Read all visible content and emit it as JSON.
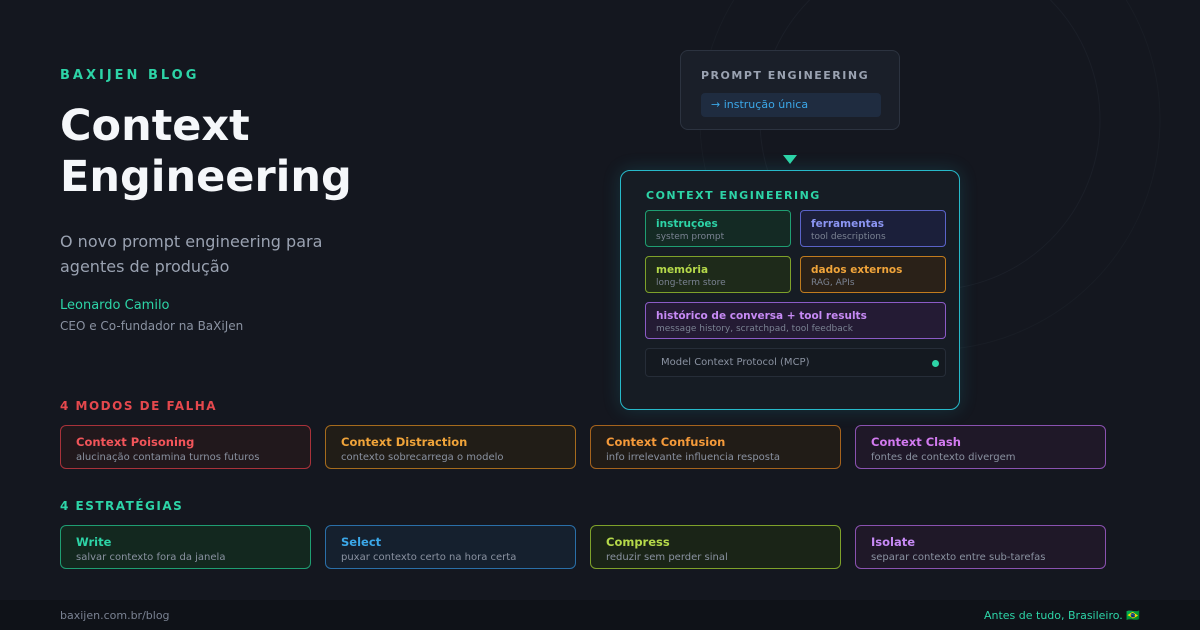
{
  "header": {
    "eyebrow": "BAXIJEN BLOG",
    "title": "Context Engineering",
    "subtitle": "O novo prompt engineering para agentes de produção",
    "author": "Leonardo Camilo",
    "role": "CEO e Co-fundador na BaXiJen"
  },
  "diagram": {
    "prompt_engineering": {
      "title": "PROMPT ENGINEERING",
      "chip": "→ instrução única"
    },
    "context_engineering": {
      "title": "CONTEXT ENGINEERING",
      "cells": [
        {
          "label": "instruções",
          "sub": "system prompt"
        },
        {
          "label": "ferramentas",
          "sub": "tool descriptions"
        },
        {
          "label": "memória",
          "sub": "long-term store"
        },
        {
          "label": "dados externos",
          "sub": "RAG, APIs"
        },
        {
          "label": "histórico de conversa + tool results",
          "sub": "message history, scratchpad, tool feedback"
        }
      ],
      "mcp": "Model Context Protocol (MCP)"
    }
  },
  "failures": {
    "title": "4 MODOS DE FALHA",
    "items": [
      {
        "label": "Context Poisoning",
        "sub": "alucinação contamina turnos futuros"
      },
      {
        "label": "Context Distraction",
        "sub": "contexto sobrecarrega o modelo"
      },
      {
        "label": "Context Confusion",
        "sub": "info irrelevante influencia resposta"
      },
      {
        "label": "Context Clash",
        "sub": "fontes de contexto divergem"
      }
    ]
  },
  "strategies": {
    "title": "4 ESTRATÉGIAS",
    "items": [
      {
        "label": "Write",
        "sub": "salvar contexto fora da janela"
      },
      {
        "label": "Select",
        "sub": "puxar contexto certo na hora certa"
      },
      {
        "label": "Compress",
        "sub": "reduzir sem perder sinal"
      },
      {
        "label": "Isolate",
        "sub": "separar contexto entre sub-tarefas"
      }
    ]
  },
  "footer": {
    "url": "baxijen.com.br/blog",
    "tagline": "Antes de tudo, Brasileiro. 🇧🇷"
  },
  "colors": {
    "background": "#14171f",
    "accent": "#2dd4a7",
    "failure": "#e5484d"
  }
}
